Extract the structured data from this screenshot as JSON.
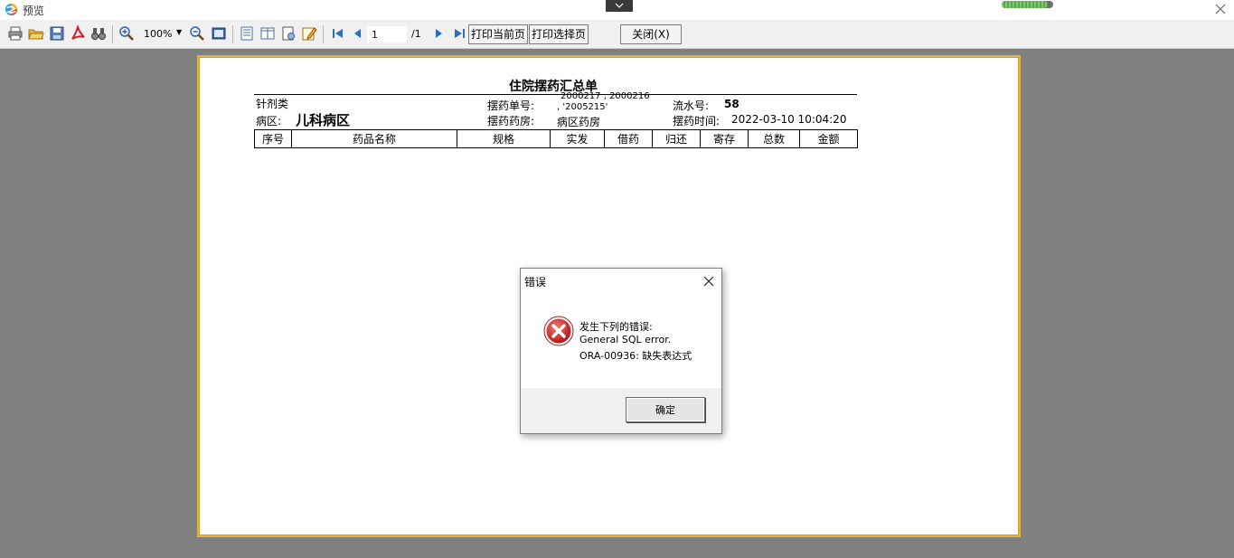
{
  "window": {
    "title": "预览",
    "progress": 0.9
  },
  "toolbar": {
    "zoom": "100%",
    "page_current": "1",
    "page_total": "/1",
    "print_current_label": "打印当前页",
    "print_selected_label": "打印选择页",
    "close_label": "关闭(X)"
  },
  "report": {
    "title": "住院摆药汇总单",
    "category": "针剂类",
    "dispense_no_label": "摆药单号:",
    "dispense_no_line1": "2000217 , 2000216",
    "dispense_no_line2": ", '2005215'",
    "serial_label": "流水号:",
    "serial_value": "58",
    "ward_label": "病区:",
    "ward_value": "儿科病区",
    "pharmacy_label": "摆药药房:",
    "pharmacy_value": "病区药房",
    "time_label": "摆药时间:",
    "time_value": "2022-03-10 10:04:20",
    "columns": [
      "序号",
      "药品名称",
      "规格",
      "实发",
      "借药",
      "归还",
      "寄存",
      "总数",
      "金额"
    ]
  },
  "dialog": {
    "title": "错误",
    "message_line1": "发生下列的错误:",
    "message_line2": "General SQL error.",
    "message_line3": "ORA-00936: 缺失表达式",
    "ok_label": "确定"
  },
  "colors": {
    "page_border": "#e0b341",
    "error_red": "#d9322f",
    "background": "#808080"
  }
}
